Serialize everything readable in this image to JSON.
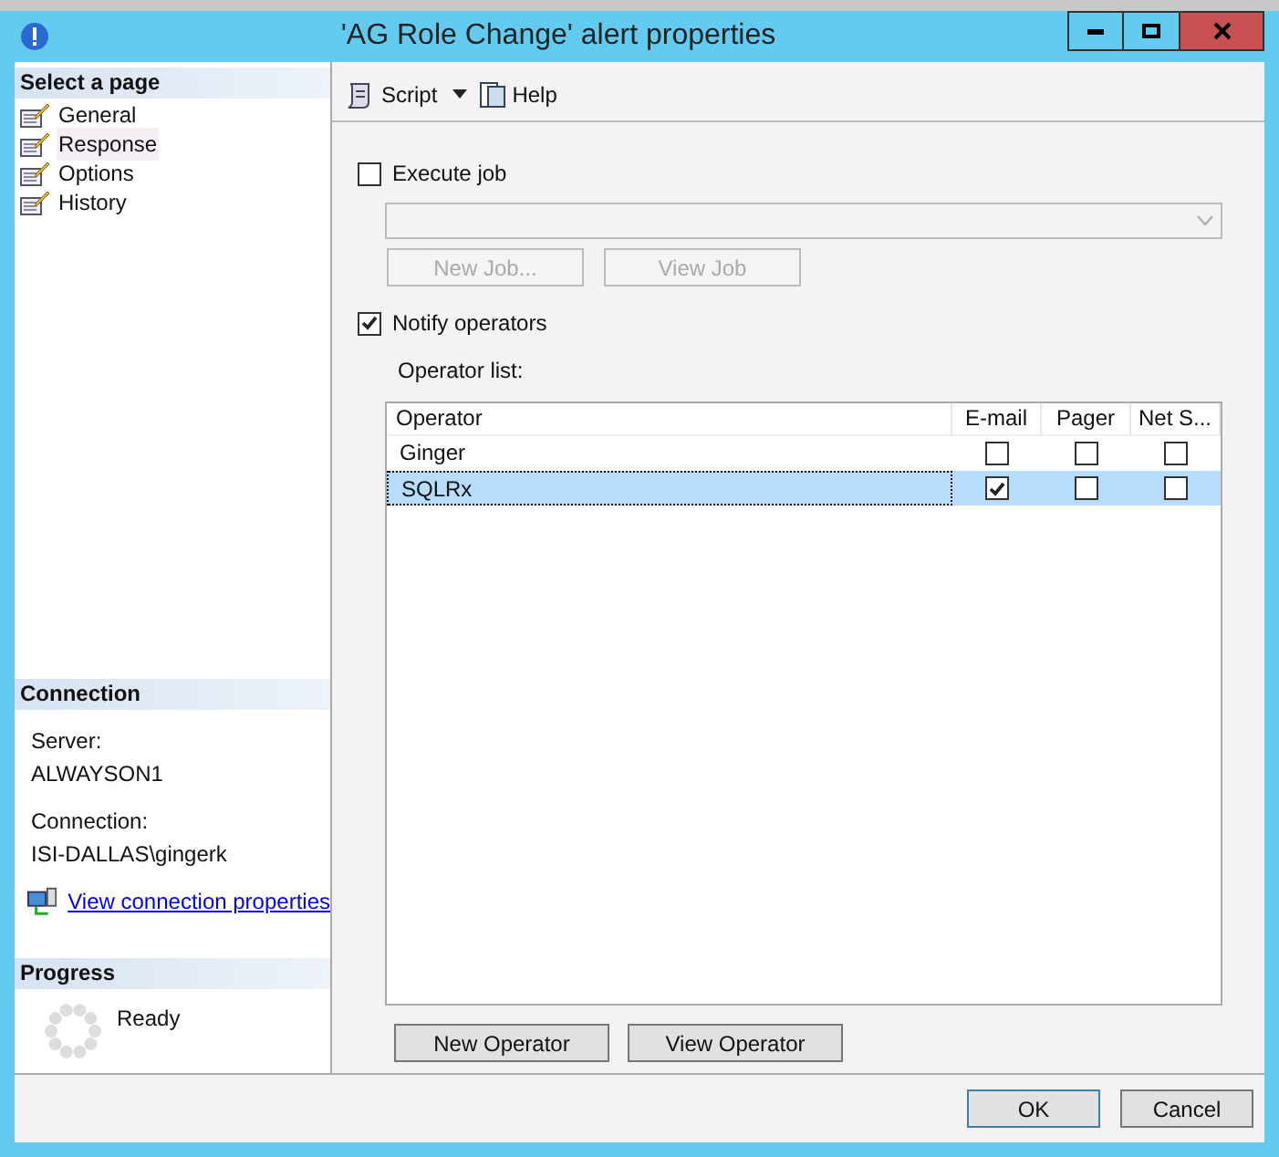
{
  "window": {
    "title": "'AG Role Change' alert properties"
  },
  "sidebar": {
    "heading": "Select a page",
    "items": [
      {
        "label": "General",
        "selected": false
      },
      {
        "label": "Response",
        "selected": true
      },
      {
        "label": "Options",
        "selected": false
      },
      {
        "label": "History",
        "selected": false
      }
    ]
  },
  "connection": {
    "heading": "Connection",
    "server_label": "Server:",
    "server": "ALWAYSON1",
    "connection_label": "Connection:",
    "connection": "ISI-DALLAS\\gingerk",
    "link": "View connection properties"
  },
  "progress": {
    "heading": "Progress",
    "status": "Ready"
  },
  "toolbar": {
    "script": "Script",
    "help": "Help"
  },
  "execute_job": {
    "label": "Execute job",
    "checked": false,
    "new_job": "New Job...",
    "view_job": "View Job"
  },
  "notify_operators": {
    "label": "Notify operators",
    "checked": true,
    "list_label": "Operator list:"
  },
  "table": {
    "columns": [
      "Operator",
      "E-mail",
      "Pager",
      "Net S..."
    ],
    "rows": [
      {
        "operator": "Ginger",
        "email": false,
        "pager": false,
        "net_send": false,
        "selected": false
      },
      {
        "operator": "SQLRx",
        "email": true,
        "pager": false,
        "net_send": false,
        "selected": true
      }
    ]
  },
  "operator_buttons": [
    "New Operator",
    "View Operator"
  ],
  "footer_buttons": [
    "OK",
    "Cancel"
  ]
}
